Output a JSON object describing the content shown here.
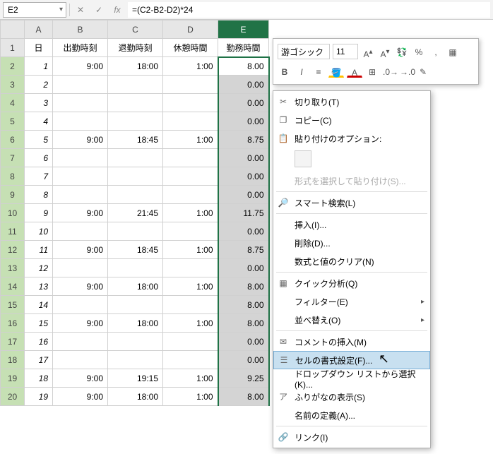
{
  "formula_bar": {
    "name_box": "E2",
    "cancel": "✕",
    "confirm": "✓",
    "fx": "fx",
    "formula": "=(C2-B2-D2)*24"
  },
  "columns": [
    "A",
    "B",
    "C",
    "D",
    "E"
  ],
  "headers": {
    "A": "日",
    "B": "出勤時刻",
    "C": "退勤時刻",
    "D": "休憩時間",
    "E": "勤務時間"
  },
  "rows": [
    {
      "n": 1,
      "A": "1",
      "B": "9:00",
      "C": "18:00",
      "D": "1:00",
      "E": "8.00"
    },
    {
      "n": 2,
      "A": "2",
      "B": "",
      "C": "",
      "D": "",
      "E": "0.00"
    },
    {
      "n": 3,
      "A": "3",
      "B": "",
      "C": "",
      "D": "",
      "E": "0.00"
    },
    {
      "n": 4,
      "A": "4",
      "B": "",
      "C": "",
      "D": "",
      "E": "0.00"
    },
    {
      "n": 5,
      "A": "5",
      "B": "9:00",
      "C": "18:45",
      "D": "1:00",
      "E": "8.75"
    },
    {
      "n": 6,
      "A": "6",
      "B": "",
      "C": "",
      "D": "",
      "E": "0.00"
    },
    {
      "n": 7,
      "A": "7",
      "B": "",
      "C": "",
      "D": "",
      "E": "0.00"
    },
    {
      "n": 8,
      "A": "8",
      "B": "",
      "C": "",
      "D": "",
      "E": "0.00"
    },
    {
      "n": 9,
      "A": "9",
      "B": "9:00",
      "C": "21:45",
      "D": "1:00",
      "E": "11.75"
    },
    {
      "n": 10,
      "A": "10",
      "B": "",
      "C": "",
      "D": "",
      "E": "0.00"
    },
    {
      "n": 11,
      "A": "11",
      "B": "9:00",
      "C": "18:45",
      "D": "1:00",
      "E": "8.75"
    },
    {
      "n": 12,
      "A": "12",
      "B": "",
      "C": "",
      "D": "",
      "E": "0.00"
    },
    {
      "n": 13,
      "A": "13",
      "B": "9:00",
      "C": "18:00",
      "D": "1:00",
      "E": "8.00"
    },
    {
      "n": 14,
      "A": "14",
      "B": "",
      "C": "",
      "D": "",
      "E": "8.00"
    },
    {
      "n": 15,
      "A": "15",
      "B": "9:00",
      "C": "18:00",
      "D": "1:00",
      "E": "8.00"
    },
    {
      "n": 16,
      "A": "16",
      "B": "",
      "C": "",
      "D": "",
      "E": "0.00"
    },
    {
      "n": 17,
      "A": "17",
      "B": "",
      "C": "",
      "D": "",
      "E": "0.00"
    },
    {
      "n": 18,
      "A": "18",
      "B": "9:00",
      "C": "19:15",
      "D": "1:00",
      "E": "9.25"
    },
    {
      "n": 19,
      "A": "19",
      "B": "9:00",
      "C": "18:00",
      "D": "1:00",
      "E": "8.00"
    }
  ],
  "mini_toolbar": {
    "font": "游ゴシック",
    "size": "11",
    "inc": "A",
    "dec": "A",
    "bold": "B",
    "italic": "I",
    "pct": "%",
    "comma": ","
  },
  "context_menu": {
    "cut": "切り取り(T)",
    "copy": "コピー(C)",
    "paste_opt": "貼り付けのオプション:",
    "paste_special": "形式を選択して貼り付け(S)...",
    "smart": "スマート検索(L)",
    "insert": "挿入(I)...",
    "delete": "削除(D)...",
    "clear": "数式と値のクリア(N)",
    "quick": "クイック分析(Q)",
    "filter": "フィルター(E)",
    "sort": "並べ替え(O)",
    "comment": "コメントの挿入(M)",
    "format": "セルの書式設定(F)...",
    "dropdown": "ドロップダウン リストから選択(K)...",
    "phonetic": "ふりがなの表示(S)",
    "name": "名前の定義(A)...",
    "link": "リンク(I)"
  }
}
